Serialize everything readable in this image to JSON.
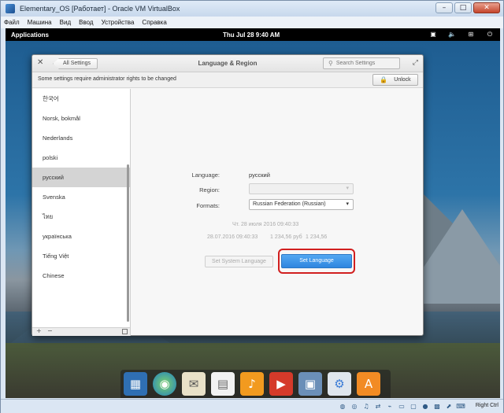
{
  "vbox": {
    "title": "Elementary_OS [Работает] - Oracle VM VirtualBox",
    "menu": [
      "Файл",
      "Машина",
      "Вид",
      "Ввод",
      "Устройства",
      "Справка"
    ],
    "controls": {
      "minimize": "–",
      "maximize": "□",
      "close": "✕"
    },
    "host_key": "Right Ctrl"
  },
  "panel": {
    "applications": "Applications",
    "clock": "Thu Jul 28    9:40 AM",
    "tray_icons": [
      "screenshot-icon",
      "volume-icon",
      "network-icon",
      "power-icon"
    ]
  },
  "settings": {
    "back_label": "All Settings",
    "title": "Language & Region",
    "search_placeholder": "Search Settings",
    "info_message": "Some settings require administrator rights to be changed",
    "unlock_label": "Unlock",
    "languages": [
      "한국어",
      "Norsk, bokmål",
      "Nederlands",
      "polski",
      "русский",
      "Svenska",
      "ไทย",
      "українська",
      "Tiếng Việt",
      "Chinese"
    ],
    "selected_language": "русский",
    "language_label": "Language:",
    "language_value": "русский",
    "region_label": "Region:",
    "region_value": "",
    "formats_label": "Formats:",
    "formats_value": "Russian Federation (Russian)",
    "preview_date_long": "Чт. 28 июля 2016 09:40:33",
    "preview_date_short": "28.07.2016   09:40:33",
    "preview_currency": "1 234,56 руб",
    "preview_number": "1 234,56",
    "set_system_label": "Set System Language",
    "set_language_label": "Set Language"
  },
  "dock": [
    "multitasking-icon",
    "browser-icon",
    "mail-icon",
    "calendar-icon",
    "music-icon",
    "videos-icon",
    "photos-icon",
    "settings-icon",
    "appcenter-icon"
  ],
  "colors": {
    "accent": "#3a8ee6",
    "highlight": "#d11f1f"
  }
}
